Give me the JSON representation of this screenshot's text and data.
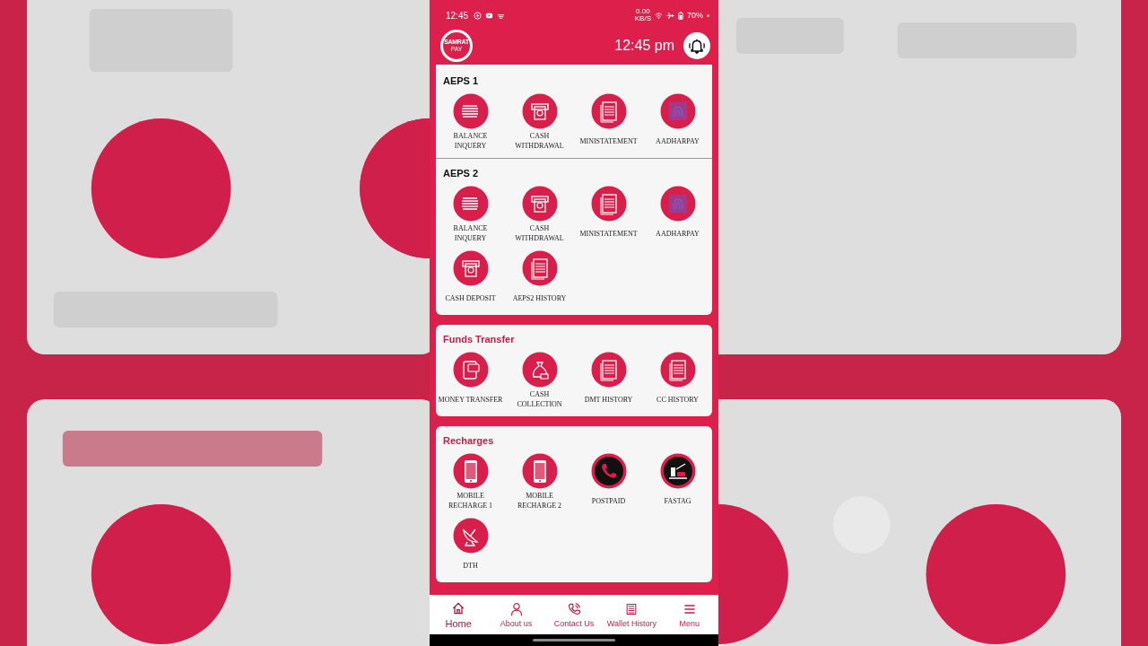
{
  "status_bar": {
    "time": "12:45",
    "speed": "0.00",
    "speed_unit": "KB/S",
    "battery": "70%"
  },
  "header": {
    "logo_top": "SAMRAT",
    "logo_bottom": "PAY",
    "clock": "12:45 pm"
  },
  "sections": [
    {
      "title": "AEPS 1",
      "accent": false,
      "items": [
        {
          "label": "BALANCE INQUERY",
          "kind": "money"
        },
        {
          "label": "CASH WITHDRAWAL",
          "kind": "atm"
        },
        {
          "label": "MINISTATEMENT",
          "kind": "document"
        },
        {
          "label": "AADHARPAY",
          "kind": "fingerprint"
        }
      ]
    },
    {
      "title": "AEPS 2",
      "accent": false,
      "items": [
        {
          "label": "BALANCE INQUERY",
          "kind": "money"
        },
        {
          "label": "CASH WITHDRAWAL",
          "kind": "atm"
        },
        {
          "label": "MINISTATEMENT",
          "kind": "document"
        },
        {
          "label": "AADHARPAY",
          "kind": "fingerprint"
        },
        {
          "label": "CASH DEPOSIT",
          "kind": "atm"
        },
        {
          "label": "AEPS2 HISTORY",
          "kind": "document"
        }
      ]
    },
    {
      "title": "Funds Transfer",
      "accent": true,
      "items": [
        {
          "label": "MONEY TRANSFER",
          "kind": "card"
        },
        {
          "label": "CASH COLLECTION",
          "kind": "bag"
        },
        {
          "label": "DMT HISTORY",
          "kind": "document"
        },
        {
          "label": "CC HISTORY",
          "kind": "document"
        }
      ]
    },
    {
      "title": "Recharges",
      "accent": true,
      "items": [
        {
          "label": "MOBILE RECHARGE 1",
          "kind": "mobile"
        },
        {
          "label": "MOBILE RECHARGE 2",
          "kind": "mobile"
        },
        {
          "label": "POSTPAID",
          "kind": "call"
        },
        {
          "label": "FASTAG",
          "kind": "toll"
        },
        {
          "label": "DTH",
          "kind": "dish"
        }
      ]
    }
  ],
  "nav": [
    {
      "label": "Home",
      "kind": "home",
      "selected": true
    },
    {
      "label": "About us",
      "kind": "person",
      "selected": false
    },
    {
      "label": "Contact Us",
      "kind": "phone",
      "selected": false
    },
    {
      "label": "Wallet History",
      "kind": "ledger",
      "selected": false
    },
    {
      "label": "Menu",
      "kind": "menu",
      "selected": false
    }
  ]
}
